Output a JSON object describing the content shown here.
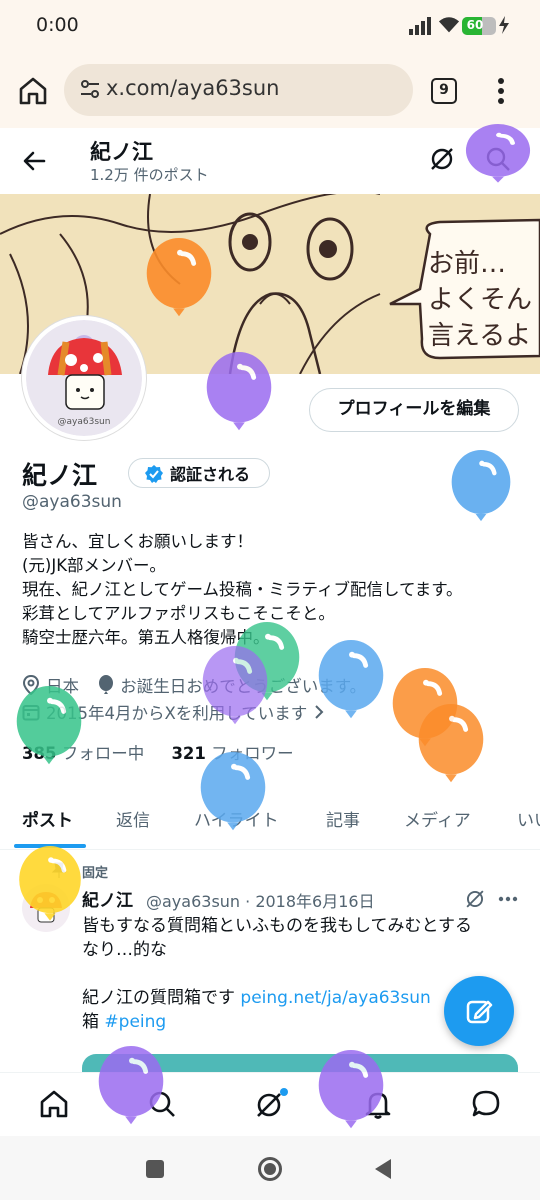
{
  "status_bar": {
    "time": "0:00",
    "battery_percent": 60,
    "battery_label": "60"
  },
  "browser": {
    "url": "x.com/aya63sun",
    "tab_count": "9"
  },
  "header": {
    "name": "紀ノ江",
    "post_count": "1.2万 件のポスト"
  },
  "banner": {
    "speech_lines": [
      "お前…",
      "よくそん",
      "言えるよ"
    ]
  },
  "profile": {
    "name": "紀ノ江",
    "verify_label": "認証される",
    "handle": "@aya63sun",
    "edit_button": "プロフィールを編集",
    "avatar_caption": "@aya63sun",
    "bio": [
      "皆さん、宜しくお願いします！",
      "(元)JK部メンバー。",
      "現在、紀ノ江としてゲーム投稿・ミラティブ配信してます。",
      "彩茸としてアルファポリスもこそこそと。",
      "騎空士歴六年。第五人格復帰中。"
    ],
    "location": "日本",
    "birthday": "お誕生日おめでとうございます。",
    "joined": "2015年4月からXを利用しています",
    "following_count": "385",
    "following_label": "フォロー中",
    "followers_count": "321",
    "followers_label": "フォロワー"
  },
  "tabs": [
    "ポスト",
    "返信",
    "ハイライト",
    "記事",
    "メディア",
    "いい"
  ],
  "pinned_post": {
    "pinned_label": "固定",
    "author": "紀ノ江",
    "handle_date": "@aya63sun · 2018年6月16日",
    "line1": "皆もすなる質問箱といふものを我もしてみむとする",
    "line2": "なり…的な",
    "line3": "紀ノ江の質問箱です ",
    "link1": "peing.net/ja/aya63sun",
    "line4": "箱 ",
    "hashtag": "#peing"
  },
  "colors": {
    "accent": "#1d9bf0",
    "balloon_purple": "#9b6cf0",
    "balloon_blue": "#5aa9ef",
    "balloon_orange": "#fb8c2a",
    "balloon_green": "#36c48a",
    "balloon_yellow": "#ffd62a"
  }
}
